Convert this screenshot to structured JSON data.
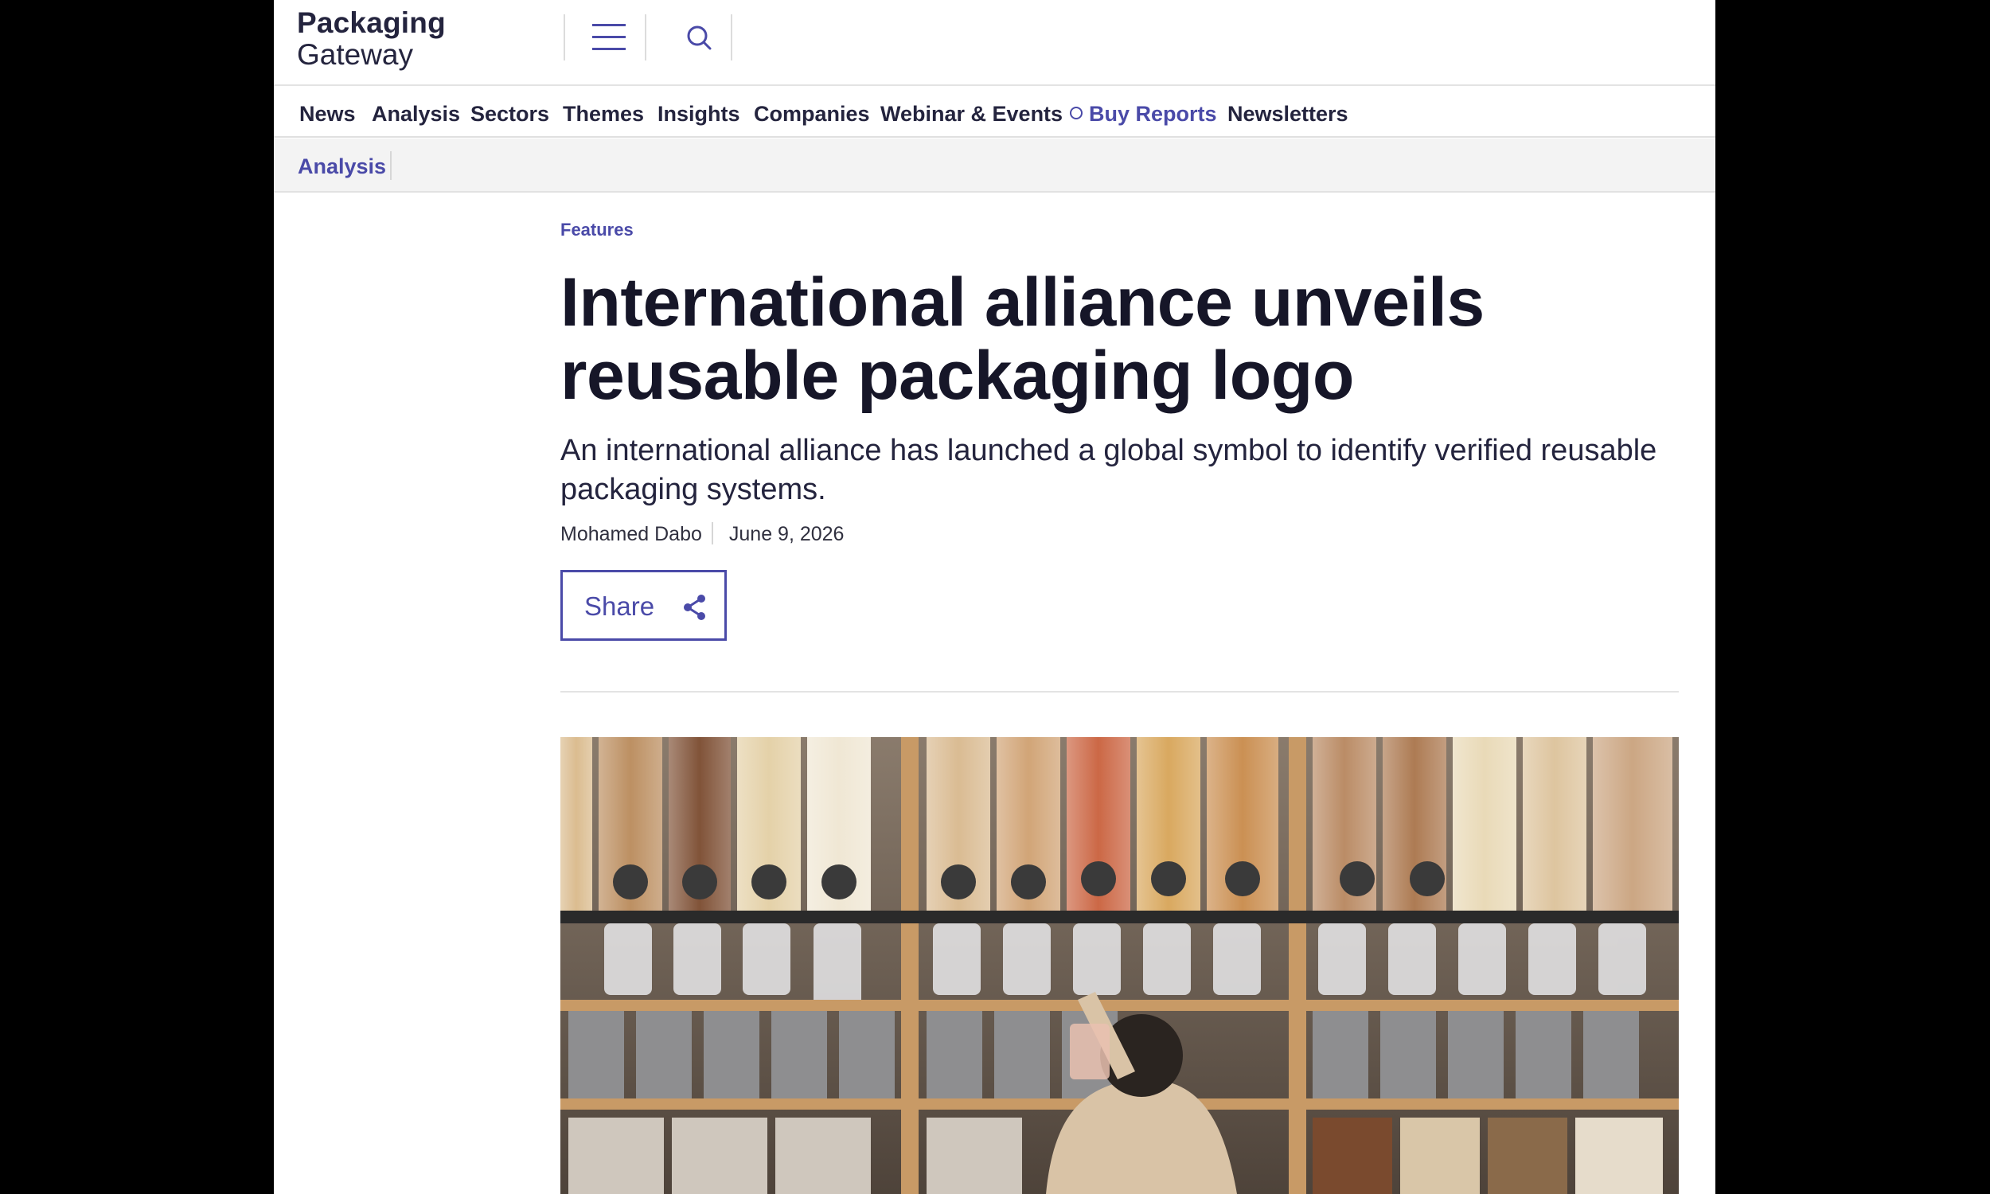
{
  "brand": {
    "line1": "Packaging",
    "line2": "Gateway"
  },
  "header": {
    "menu_icon": "hamburger-menu-icon",
    "search_icon": "search-icon"
  },
  "nav": {
    "items": [
      {
        "label": "News"
      },
      {
        "label": "Analysis"
      },
      {
        "label": "Sectors"
      },
      {
        "label": "Themes"
      },
      {
        "label": "Insights"
      },
      {
        "label": "Companies"
      },
      {
        "label": "Webinar & Events"
      },
      {
        "label": "Buy Reports",
        "icon": "report-icon"
      },
      {
        "label": "Newsletters"
      }
    ]
  },
  "subnav": {
    "active": "Analysis"
  },
  "article": {
    "category": "Features",
    "title": "International alliance unveils reusable packaging logo",
    "standfirst": "An international alliance has launched a global symbol to identify verified reusable packaging systems.",
    "author": "Mohamed Dabo",
    "date": "June 9, 2026",
    "share_label": "Share",
    "share_icon": "share-icon"
  },
  "colors": {
    "accent": "#4a4aa8",
    "text_dark": "#161628",
    "subnav_bg": "#f3f3f3"
  }
}
